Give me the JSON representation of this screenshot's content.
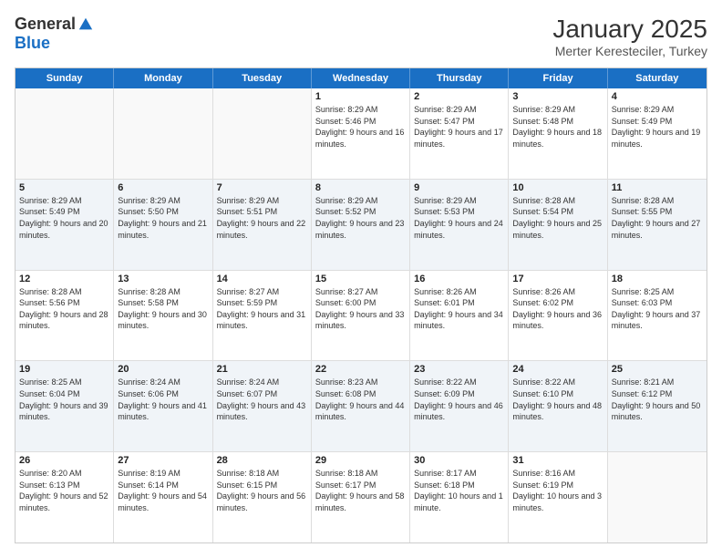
{
  "header": {
    "logo_general": "General",
    "logo_blue": "Blue",
    "month_title": "January 2025",
    "subtitle": "Merter Keresteciler, Turkey"
  },
  "weekdays": [
    "Sunday",
    "Monday",
    "Tuesday",
    "Wednesday",
    "Thursday",
    "Friday",
    "Saturday"
  ],
  "rows": [
    {
      "alt": false,
      "cells": [
        {
          "day": "",
          "sunrise": "",
          "sunset": "",
          "daylight": ""
        },
        {
          "day": "",
          "sunrise": "",
          "sunset": "",
          "daylight": ""
        },
        {
          "day": "",
          "sunrise": "",
          "sunset": "",
          "daylight": ""
        },
        {
          "day": "1",
          "sunrise": "Sunrise: 8:29 AM",
          "sunset": "Sunset: 5:46 PM",
          "daylight": "Daylight: 9 hours and 16 minutes."
        },
        {
          "day": "2",
          "sunrise": "Sunrise: 8:29 AM",
          "sunset": "Sunset: 5:47 PM",
          "daylight": "Daylight: 9 hours and 17 minutes."
        },
        {
          "day": "3",
          "sunrise": "Sunrise: 8:29 AM",
          "sunset": "Sunset: 5:48 PM",
          "daylight": "Daylight: 9 hours and 18 minutes."
        },
        {
          "day": "4",
          "sunrise": "Sunrise: 8:29 AM",
          "sunset": "Sunset: 5:49 PM",
          "daylight": "Daylight: 9 hours and 19 minutes."
        }
      ]
    },
    {
      "alt": true,
      "cells": [
        {
          "day": "5",
          "sunrise": "Sunrise: 8:29 AM",
          "sunset": "Sunset: 5:49 PM",
          "daylight": "Daylight: 9 hours and 20 minutes."
        },
        {
          "day": "6",
          "sunrise": "Sunrise: 8:29 AM",
          "sunset": "Sunset: 5:50 PM",
          "daylight": "Daylight: 9 hours and 21 minutes."
        },
        {
          "day": "7",
          "sunrise": "Sunrise: 8:29 AM",
          "sunset": "Sunset: 5:51 PM",
          "daylight": "Daylight: 9 hours and 22 minutes."
        },
        {
          "day": "8",
          "sunrise": "Sunrise: 8:29 AM",
          "sunset": "Sunset: 5:52 PM",
          "daylight": "Daylight: 9 hours and 23 minutes."
        },
        {
          "day": "9",
          "sunrise": "Sunrise: 8:29 AM",
          "sunset": "Sunset: 5:53 PM",
          "daylight": "Daylight: 9 hours and 24 minutes."
        },
        {
          "day": "10",
          "sunrise": "Sunrise: 8:28 AM",
          "sunset": "Sunset: 5:54 PM",
          "daylight": "Daylight: 9 hours and 25 minutes."
        },
        {
          "day": "11",
          "sunrise": "Sunrise: 8:28 AM",
          "sunset": "Sunset: 5:55 PM",
          "daylight": "Daylight: 9 hours and 27 minutes."
        }
      ]
    },
    {
      "alt": false,
      "cells": [
        {
          "day": "12",
          "sunrise": "Sunrise: 8:28 AM",
          "sunset": "Sunset: 5:56 PM",
          "daylight": "Daylight: 9 hours and 28 minutes."
        },
        {
          "day": "13",
          "sunrise": "Sunrise: 8:28 AM",
          "sunset": "Sunset: 5:58 PM",
          "daylight": "Daylight: 9 hours and 30 minutes."
        },
        {
          "day": "14",
          "sunrise": "Sunrise: 8:27 AM",
          "sunset": "Sunset: 5:59 PM",
          "daylight": "Daylight: 9 hours and 31 minutes."
        },
        {
          "day": "15",
          "sunrise": "Sunrise: 8:27 AM",
          "sunset": "Sunset: 6:00 PM",
          "daylight": "Daylight: 9 hours and 33 minutes."
        },
        {
          "day": "16",
          "sunrise": "Sunrise: 8:26 AM",
          "sunset": "Sunset: 6:01 PM",
          "daylight": "Daylight: 9 hours and 34 minutes."
        },
        {
          "day": "17",
          "sunrise": "Sunrise: 8:26 AM",
          "sunset": "Sunset: 6:02 PM",
          "daylight": "Daylight: 9 hours and 36 minutes."
        },
        {
          "day": "18",
          "sunrise": "Sunrise: 8:25 AM",
          "sunset": "Sunset: 6:03 PM",
          "daylight": "Daylight: 9 hours and 37 minutes."
        }
      ]
    },
    {
      "alt": true,
      "cells": [
        {
          "day": "19",
          "sunrise": "Sunrise: 8:25 AM",
          "sunset": "Sunset: 6:04 PM",
          "daylight": "Daylight: 9 hours and 39 minutes."
        },
        {
          "day": "20",
          "sunrise": "Sunrise: 8:24 AM",
          "sunset": "Sunset: 6:06 PM",
          "daylight": "Daylight: 9 hours and 41 minutes."
        },
        {
          "day": "21",
          "sunrise": "Sunrise: 8:24 AM",
          "sunset": "Sunset: 6:07 PM",
          "daylight": "Daylight: 9 hours and 43 minutes."
        },
        {
          "day": "22",
          "sunrise": "Sunrise: 8:23 AM",
          "sunset": "Sunset: 6:08 PM",
          "daylight": "Daylight: 9 hours and 44 minutes."
        },
        {
          "day": "23",
          "sunrise": "Sunrise: 8:22 AM",
          "sunset": "Sunset: 6:09 PM",
          "daylight": "Daylight: 9 hours and 46 minutes."
        },
        {
          "day": "24",
          "sunrise": "Sunrise: 8:22 AM",
          "sunset": "Sunset: 6:10 PM",
          "daylight": "Daylight: 9 hours and 48 minutes."
        },
        {
          "day": "25",
          "sunrise": "Sunrise: 8:21 AM",
          "sunset": "Sunset: 6:12 PM",
          "daylight": "Daylight: 9 hours and 50 minutes."
        }
      ]
    },
    {
      "alt": false,
      "cells": [
        {
          "day": "26",
          "sunrise": "Sunrise: 8:20 AM",
          "sunset": "Sunset: 6:13 PM",
          "daylight": "Daylight: 9 hours and 52 minutes."
        },
        {
          "day": "27",
          "sunrise": "Sunrise: 8:19 AM",
          "sunset": "Sunset: 6:14 PM",
          "daylight": "Daylight: 9 hours and 54 minutes."
        },
        {
          "day": "28",
          "sunrise": "Sunrise: 8:18 AM",
          "sunset": "Sunset: 6:15 PM",
          "daylight": "Daylight: 9 hours and 56 minutes."
        },
        {
          "day": "29",
          "sunrise": "Sunrise: 8:18 AM",
          "sunset": "Sunset: 6:17 PM",
          "daylight": "Daylight: 9 hours and 58 minutes."
        },
        {
          "day": "30",
          "sunrise": "Sunrise: 8:17 AM",
          "sunset": "Sunset: 6:18 PM",
          "daylight": "Daylight: 10 hours and 1 minute."
        },
        {
          "day": "31",
          "sunrise": "Sunrise: 8:16 AM",
          "sunset": "Sunset: 6:19 PM",
          "daylight": "Daylight: 10 hours and 3 minutes."
        },
        {
          "day": "",
          "sunrise": "",
          "sunset": "",
          "daylight": ""
        }
      ]
    }
  ]
}
